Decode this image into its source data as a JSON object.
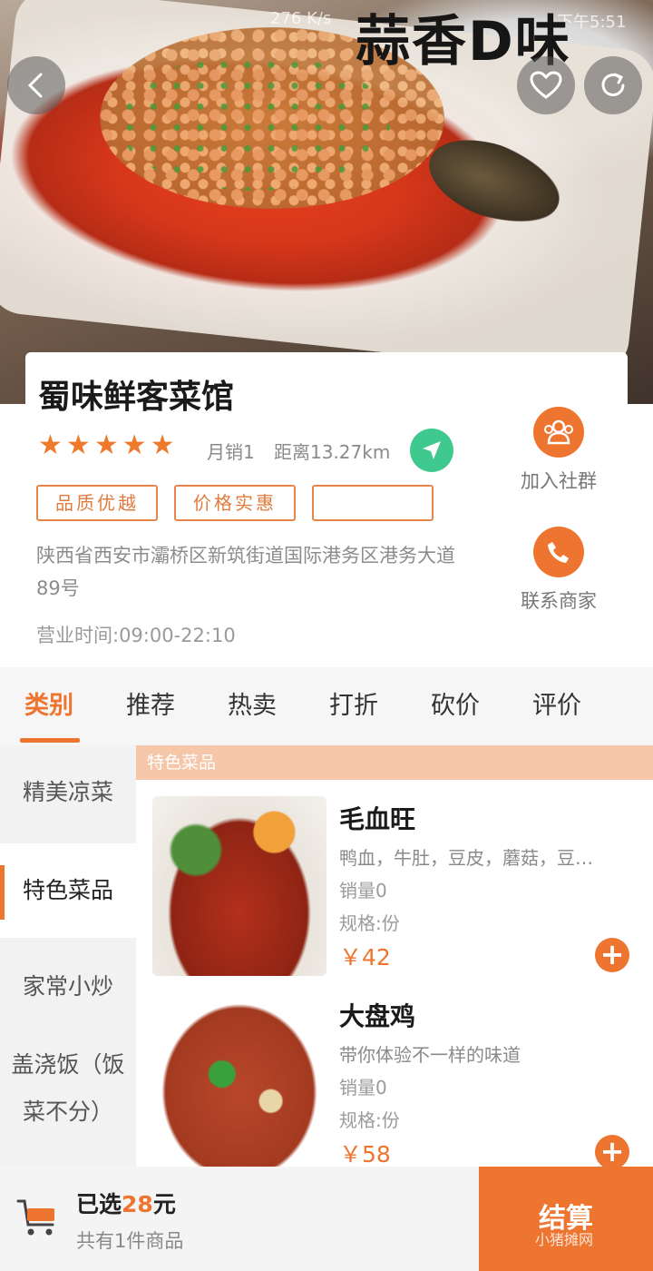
{
  "status_overlay": {
    "speed": "276 K/s",
    "time": "下午5:51"
  },
  "brand_logo": "蒜香D味",
  "shop": {
    "name": "蜀味鲜客菜馆",
    "rating_stars": 5,
    "monthly_sales": "月销1",
    "distance": "距离13.27km",
    "tags": [
      "品质优越",
      "价格实惠",
      ""
    ],
    "address": "陕西省西安市灞桥区新筑街道国际港务区港务大道89号",
    "hours": "营业时间:09:00-22:10",
    "join_group_label": "加入社群",
    "contact_label": "联系商家"
  },
  "tabs": [
    "类别",
    "推荐",
    "热卖",
    "打折",
    "砍价",
    "评价"
  ],
  "categories": [
    "精美凉菜",
    "特色菜品",
    "家常小炒",
    "盖浇饭（饭",
    "菜不分）"
  ],
  "section_title": "特色菜品",
  "foods": [
    {
      "name": "毛血旺",
      "desc": "鸭血，牛肚，豆皮，蘑菇，豆…",
      "sales": "销量0",
      "spec": "规格:份",
      "price": "￥42",
      "add": "+"
    },
    {
      "name": "大盘鸡",
      "desc": "带你体验不一样的味道",
      "sales": "销量0",
      "spec": "规格:份",
      "price": "￥58",
      "add": "+"
    }
  ],
  "cart": {
    "selected_prefix": "已选",
    "selected_amount": "28",
    "selected_suffix": "元",
    "count_text": "共有1件商品",
    "checkout_label": "结算"
  },
  "watermark": "小猪摊网",
  "colors": {
    "accent": "#ee7530",
    "nav_green": "#3fc98e",
    "section_head": "#f6c6a8"
  }
}
